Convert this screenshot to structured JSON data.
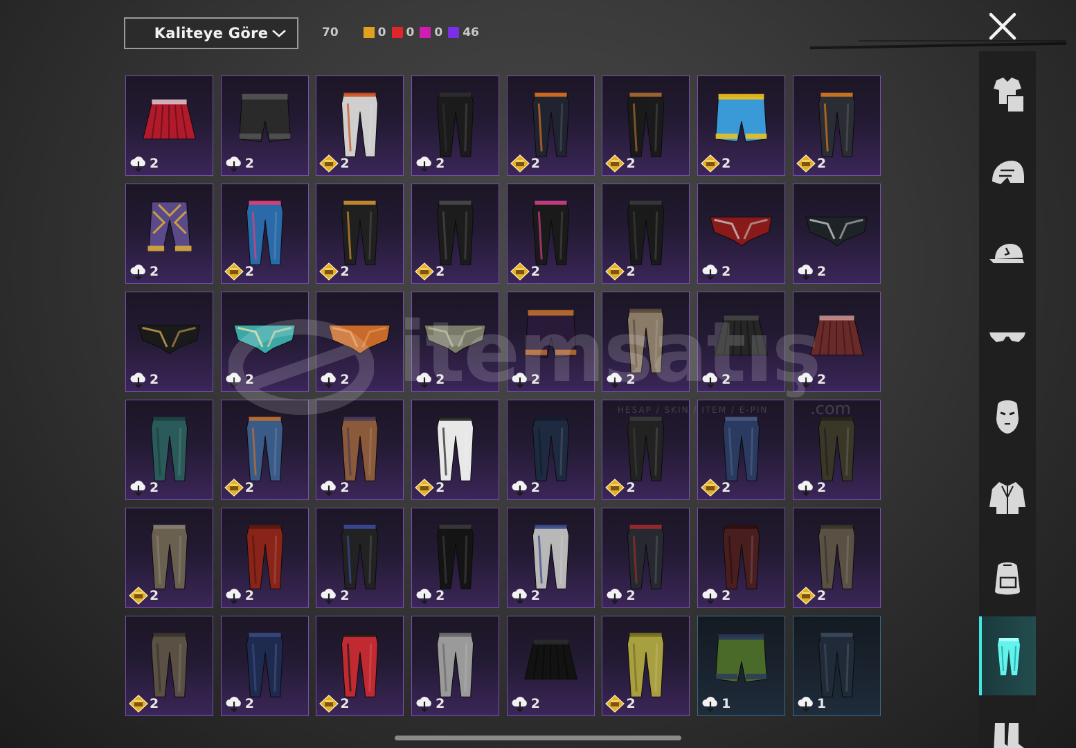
{
  "toolbar": {
    "sort_label": "Kaliteye Göre",
    "total_count": "70",
    "rarity_counts": [
      {
        "color": "#e0a020",
        "value": "0"
      },
      {
        "color": "#e0242a",
        "value": "0"
      },
      {
        "color": "#d21bb0",
        "value": "0"
      },
      {
        "color": "#7a2ee6",
        "value": "46"
      }
    ],
    "close_icon": "close-icon"
  },
  "watermark": {
    "brand": "itemsatış",
    "tagline": "HESAP / SKIN / ITEM / E-PIN",
    "suffix": ".com"
  },
  "sidebar": {
    "active": "pants",
    "items": [
      {
        "name": "outfit-icon",
        "key": "outfit"
      },
      {
        "name": "helmet-icon",
        "key": "helmet"
      },
      {
        "name": "cap-icon",
        "key": "cap"
      },
      {
        "name": "glasses-icon",
        "key": "glasses"
      },
      {
        "name": "mask-icon",
        "key": "mask"
      },
      {
        "name": "jacket-icon",
        "key": "jacket"
      },
      {
        "name": "backpack-icon",
        "key": "backpack"
      },
      {
        "name": "pants-icon",
        "key": "pants"
      },
      {
        "name": "boots-icon",
        "key": "boots"
      }
    ]
  },
  "items": [
    {
      "kind": "skirt",
      "c1": "#b01a2a",
      "c2": "#e0c0c8",
      "badge": "cloud",
      "count": "2",
      "rarity": "epic"
    },
    {
      "kind": "shorts",
      "c1": "#2a2a2a",
      "c2": "#555555",
      "badge": "cloud",
      "count": "2",
      "rarity": "epic"
    },
    {
      "kind": "pants",
      "c1": "#cfcfcf",
      "c2": "#d0501f",
      "badge": "crate",
      "count": "2",
      "rarity": "epic"
    },
    {
      "kind": "pants",
      "c1": "#1b1b1b",
      "c2": "#2e2e2e",
      "badge": "cloud",
      "count": "2",
      "rarity": "epic"
    },
    {
      "kind": "pants",
      "c1": "#1f2430",
      "c2": "#e07020",
      "badge": "crate",
      "count": "2",
      "rarity": "epic"
    },
    {
      "kind": "pants",
      "c1": "#1a1a1a",
      "c2": "#a86a30",
      "badge": "crate",
      "count": "2",
      "rarity": "epic"
    },
    {
      "kind": "shorts",
      "c1": "#3a9ad8",
      "c2": "#f2c21b",
      "badge": "crate",
      "count": "2",
      "rarity": "epic"
    },
    {
      "kind": "pants",
      "c1": "#2a2d33",
      "c2": "#d87a20",
      "badge": "crate",
      "count": "2",
      "rarity": "epic"
    },
    {
      "kind": "capri",
      "c1": "#5a4a8a",
      "c2": "#c8a040",
      "badge": "cloud",
      "count": "2",
      "rarity": "epic"
    },
    {
      "kind": "pants",
      "c1": "#2a6aa8",
      "c2": "#e0407a",
      "badge": "crate",
      "count": "2",
      "rarity": "epic"
    },
    {
      "kind": "pants",
      "c1": "#202020",
      "c2": "#d09030",
      "badge": "crate",
      "count": "2",
      "rarity": "epic"
    },
    {
      "kind": "pants",
      "c1": "#1c1c1c",
      "c2": "#4a4a4a",
      "badge": "crate",
      "count": "2",
      "rarity": "epic"
    },
    {
      "kind": "pants",
      "c1": "#1a1a1a",
      "c2": "#d0408a",
      "badge": "crate",
      "count": "2",
      "rarity": "epic"
    },
    {
      "kind": "pants",
      "c1": "#1a1a1a",
      "c2": "#3a3a3a",
      "badge": "crate",
      "count": "2",
      "rarity": "epic"
    },
    {
      "kind": "briefs",
      "c1": "#8a1a1a",
      "c2": "#c8c8c8",
      "badge": "cloud",
      "count": "2",
      "rarity": "epic"
    },
    {
      "kind": "briefs",
      "c1": "#1e2328",
      "c2": "#c8c8c8",
      "badge": "cloud",
      "count": "2",
      "rarity": "epic"
    },
    {
      "kind": "briefs",
      "c1": "#1a1a1a",
      "c2": "#c8a850",
      "badge": "cloud",
      "count": "2",
      "rarity": "epic"
    },
    {
      "kind": "briefs",
      "c1": "#3aa8a8",
      "c2": "#f0e0a0",
      "badge": "cloud",
      "count": "2",
      "rarity": "epic"
    },
    {
      "kind": "briefs",
      "c1": "#c86a2a",
      "c2": "#e8a060",
      "badge": "cloud",
      "count": "2",
      "rarity": "epic"
    },
    {
      "kind": "briefs",
      "c1": "#7a7a6a",
      "c2": "#b8b890",
      "badge": "cloud",
      "count": "2",
      "rarity": "epic"
    },
    {
      "kind": "shorts",
      "c1": "#2a1a3a",
      "c2": "#c07030",
      "badge": "cloud",
      "count": "2",
      "rarity": "epic"
    },
    {
      "kind": "pants",
      "c1": "#8a7a68",
      "c2": "#5a4a3a",
      "badge": "cloud",
      "count": "2",
      "rarity": "epic"
    },
    {
      "kind": "skirt",
      "c1": "#262626",
      "c2": "#444444",
      "badge": "cloud",
      "count": "2",
      "rarity": "epic"
    },
    {
      "kind": "skirt",
      "c1": "#6a2a2a",
      "c2": "#c89090",
      "badge": "cloud",
      "count": "2",
      "rarity": "epic"
    },
    {
      "kind": "pants",
      "c1": "#2a5a5a",
      "c2": "#1e4040",
      "badge": "cloud",
      "count": "2",
      "rarity": "epic"
    },
    {
      "kind": "pants",
      "c1": "#3a5a88",
      "c2": "#c07030",
      "badge": "crate",
      "count": "2",
      "rarity": "epic"
    },
    {
      "kind": "pants",
      "c1": "#8a5a3a",
      "c2": "#4a3a5a",
      "badge": "cloud",
      "count": "2",
      "rarity": "epic"
    },
    {
      "kind": "pants",
      "c1": "#e8e8e8",
      "c2": "#202020",
      "badge": "crate",
      "count": "2",
      "rarity": "epic"
    },
    {
      "kind": "pants",
      "c1": "#1e2a40",
      "c2": "#141c2c",
      "badge": "cloud",
      "count": "2",
      "rarity": "epic"
    },
    {
      "kind": "pants",
      "c1": "#222222",
      "c2": "#3a3a3a",
      "badge": "crate",
      "count": "2",
      "rarity": "epic"
    },
    {
      "kind": "pants",
      "c1": "#2a3a60",
      "c2": "#4a5a80",
      "badge": "crate",
      "count": "2",
      "rarity": "epic"
    },
    {
      "kind": "pants",
      "c1": "#3a3628",
      "c2": "#24221a",
      "badge": "cloud",
      "count": "2",
      "rarity": "epic"
    },
    {
      "kind": "pants",
      "c1": "#6a6050",
      "c2": "#8a8070",
      "badge": "crate",
      "count": "2",
      "rarity": "epic"
    },
    {
      "kind": "pants",
      "c1": "#8a2418",
      "c2": "#5a1810",
      "badge": "cloud",
      "count": "2",
      "rarity": "epic"
    },
    {
      "kind": "pants",
      "c1": "#222222",
      "c2": "#3a4a9a",
      "badge": "cloud",
      "count": "2",
      "rarity": "epic"
    },
    {
      "kind": "pants",
      "c1": "#141414",
      "c2": "#3a3a3a",
      "badge": "cloud",
      "count": "2",
      "rarity": "epic"
    },
    {
      "kind": "pants",
      "c1": "#b8b8b8",
      "c2": "#3a4a8a",
      "badge": "cloud",
      "count": "2",
      "rarity": "epic"
    },
    {
      "kind": "pants",
      "c1": "#262a30",
      "c2": "#a02a2a",
      "badge": "cloud",
      "count": "2",
      "rarity": "epic"
    },
    {
      "kind": "pants",
      "c1": "#4a1e1e",
      "c2": "#2a1010",
      "badge": "cloud",
      "count": "2",
      "rarity": "epic"
    },
    {
      "kind": "pants",
      "c1": "#5a5044",
      "c2": "#3a342c",
      "badge": "crate",
      "count": "2",
      "rarity": "epic"
    },
    {
      "kind": "pants",
      "c1": "#5a5044",
      "c2": "#3a342c",
      "badge": "crate",
      "count": "2",
      "rarity": "epic"
    },
    {
      "kind": "pants",
      "c1": "#1e2a50",
      "c2": "#3a4a80",
      "badge": "cloud",
      "count": "2",
      "rarity": "epic"
    },
    {
      "kind": "pants",
      "c1": "#c02a30",
      "c2": "#1a1a1a",
      "badge": "crate",
      "count": "2",
      "rarity": "epic"
    },
    {
      "kind": "pants",
      "c1": "#9a9a9a",
      "c2": "#6a6a6a",
      "badge": "cloud",
      "count": "2",
      "rarity": "epic"
    },
    {
      "kind": "skirt",
      "c1": "#121212",
      "c2": "#2a2a2a",
      "badge": "cloud",
      "count": "2",
      "rarity": "epic"
    },
    {
      "kind": "pants",
      "c1": "#a8a040",
      "c2": "#787020",
      "badge": "crate",
      "count": "2",
      "rarity": "epic"
    },
    {
      "kind": "shorts",
      "c1": "#4a6a2a",
      "c2": "#2a3a5a",
      "badge": "cloud",
      "count": "1",
      "rarity": "common"
    },
    {
      "kind": "pants",
      "c1": "#202a38",
      "c2": "#3a4a5a",
      "badge": "cloud",
      "count": "1",
      "rarity": "common"
    }
  ]
}
